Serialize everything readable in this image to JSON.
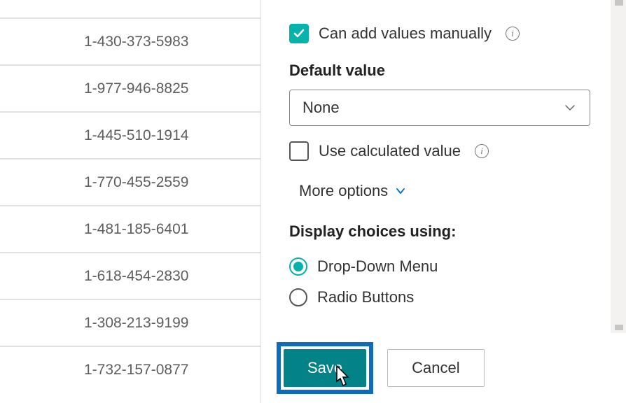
{
  "list": {
    "rows": [
      {
        "value": ""
      },
      {
        "value": "1-430-373-5983"
      },
      {
        "value": "1-977-946-8825"
      },
      {
        "value": "1-445-510-1914"
      },
      {
        "value": "1-770-455-2559"
      },
      {
        "value": "1-481-185-6401"
      },
      {
        "value": "1-618-454-2830"
      },
      {
        "value": "1-308-213-9199"
      },
      {
        "value": "1-732-157-0877"
      }
    ]
  },
  "panel": {
    "can_add_label": "Can add values manually",
    "default_value_label": "Default value",
    "default_value_selected": "None",
    "use_calc_label": "Use calculated value",
    "more_options_label": "More options",
    "display_label": "Display choices using:",
    "radio_dropdown": "Drop-Down Menu",
    "radio_radio": "Radio Buttons"
  },
  "footer": {
    "save": "Save",
    "cancel": "Cancel"
  },
  "colors": {
    "teal": "#05b3ab",
    "highlight": "#0f6cbd"
  }
}
